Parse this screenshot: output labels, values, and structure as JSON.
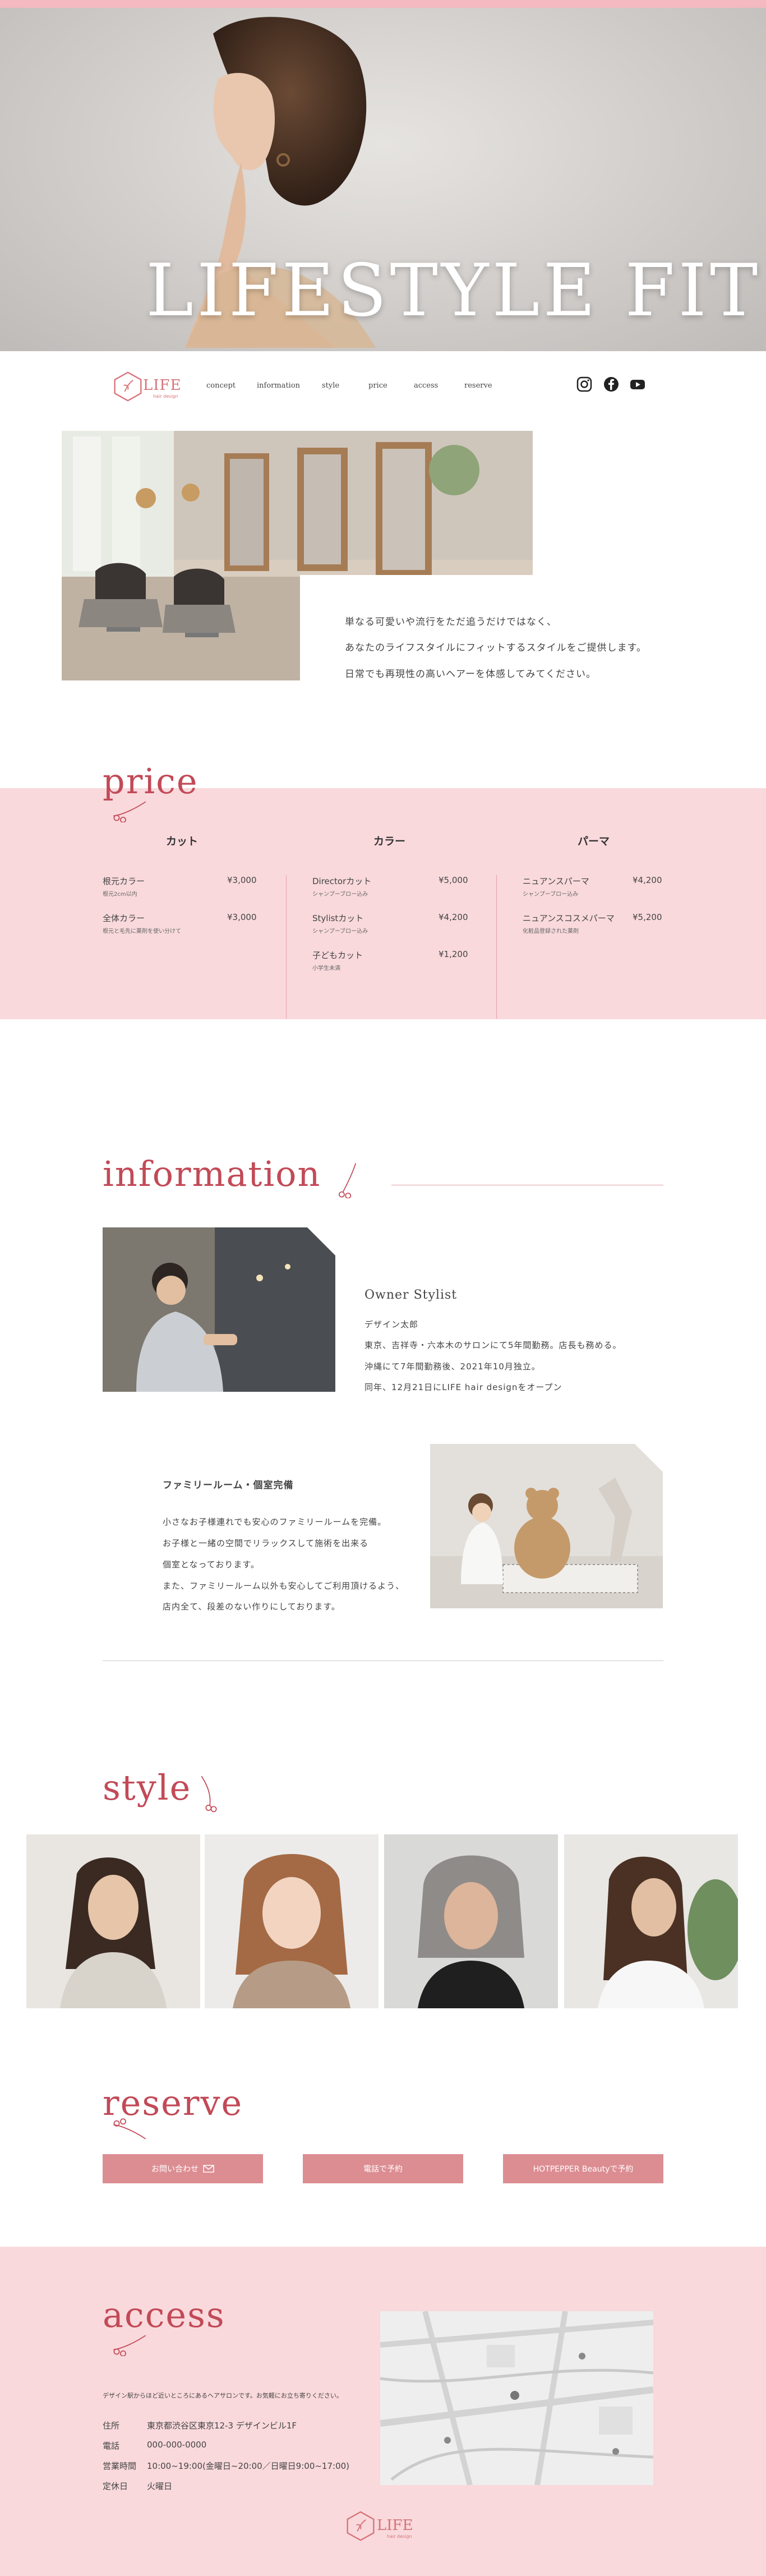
{
  "hero": {
    "title": "LIFESTYLE  FIT"
  },
  "brand": {
    "name": "LIFE",
    "sub": "hair design"
  },
  "nav": {
    "links": [
      "concept",
      "information",
      "style",
      "price",
      "access",
      "reserve"
    ],
    "social": [
      "instagram-icon",
      "facebook-icon",
      "youtube-icon"
    ]
  },
  "about": {
    "lines": [
      "単なる可愛いや流行をただ追うだけではなく、",
      "あなたのライフスタイルにフィットするスタイルをご提供します。",
      "日常でも再現性の高いヘアーを体感してみてください。"
    ]
  },
  "price": {
    "title": "price",
    "columns": [
      {
        "head": "カット",
        "items": [
          {
            "name": "根元カラー",
            "note": "根元2cm以内",
            "price": "¥3,000"
          },
          {
            "name": "全体カラー",
            "note": "根元と毛先に薬剤を使い分けて",
            "price": "¥3,000"
          }
        ]
      },
      {
        "head": "カラー",
        "items": [
          {
            "name": "Directorカット",
            "note": "シャンプーブロー込み",
            "price": "¥5,000"
          },
          {
            "name": "Stylistカット",
            "note": "シャンプーブロー込み",
            "price": "¥4,200"
          },
          {
            "name": "子どもカット",
            "note": "小学生未満",
            "price": "¥1,200"
          }
        ]
      },
      {
        "head": "パーマ",
        "items": [
          {
            "name": "ニュアンスパーマ",
            "note": "シャンプーブロー込み",
            "price": "¥4,200"
          },
          {
            "name": "ニュアンスコスメパーマ",
            "note": "化粧品登録された薬剤",
            "price": "¥5,200"
          }
        ]
      }
    ]
  },
  "information": {
    "title": "information",
    "stylist": {
      "heading": "Owner Stylist",
      "lines": [
        "デザイン太郎",
        "東京、吉祥寺・六本木のサロンにて5年間勤務。店長も務める。",
        "沖縄にて7年間勤務後、2021年10月独立。",
        "同年、12月21日にLIFE hair designをオープン"
      ]
    },
    "family": {
      "heading": "ファミリールーム・個室完備",
      "lines": [
        "小さなお子様連れでも安心のファミリールームを完備。",
        "お子様と一緒の空間でリラックスして施術を出来る",
        "個室となっております。",
        "また、ファミリールーム以外も安心してご利用頂けるよう、",
        "店内全て、段差のない作りにしております。"
      ]
    }
  },
  "style": {
    "title": "style"
  },
  "reserve": {
    "title": "reserve",
    "buttons": [
      "お問い合わせ",
      "電話で予約",
      "HOTPEPPER Beautyで予約"
    ]
  },
  "access": {
    "title": "access",
    "intro": "デザイン駅からほど近いところにあるヘアサロンです。お気軽にお立ち寄りください。",
    "rows": [
      {
        "label": "住所",
        "value": "東京都渋谷区東京12-3 デザインビル1F"
      },
      {
        "label": "電話",
        "value": "000-000-0000"
      },
      {
        "label": "営業時間",
        "value": "10:00~19:00(金曜日~20:00／日曜日9:00~17:00)"
      },
      {
        "label": "定休日",
        "value": "火曜日"
      }
    ]
  },
  "colors": {
    "accent": "#c24a57",
    "pink_band": "#f9d9dc",
    "button": "#dc8d92",
    "top_strip": "#f4b9c1"
  }
}
